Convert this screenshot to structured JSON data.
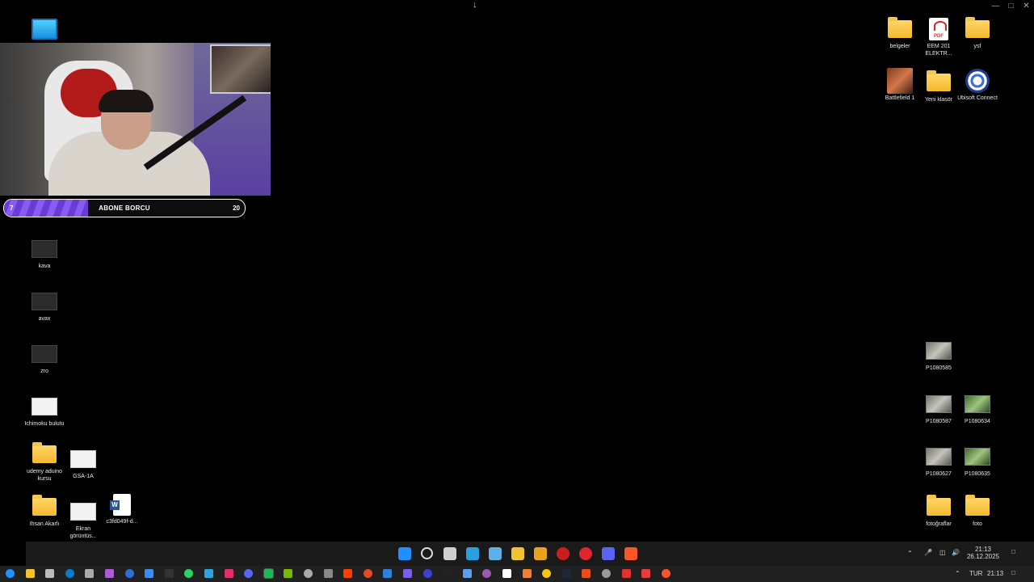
{
  "desktop": {
    "left_icons": [
      {
        "label": "kava",
        "kind": "thumb"
      },
      {
        "label": "avax",
        "kind": "thumb"
      },
      {
        "label": "zro",
        "kind": "thumb"
      },
      {
        "label": "Ichimoku bulutu",
        "kind": "thumb-white"
      },
      {
        "label": "udemy aduino kursu",
        "kind": "folder"
      },
      {
        "label": "GSA-1A",
        "kind": "thumb-white"
      },
      {
        "label": "Ihsan Akarlı",
        "kind": "folder"
      },
      {
        "label": "Ekran görüntüs...",
        "kind": "thumb-white"
      },
      {
        "label": "c3fd049f-d...",
        "kind": "word"
      }
    ],
    "right_icons": [
      {
        "label": "belgeler",
        "kind": "folder"
      },
      {
        "label": "EEM 201 ELEKTR...",
        "kind": "pdf"
      },
      {
        "label": "ysf",
        "kind": "folder"
      },
      {
        "label": "Battlefield 1",
        "kind": "game"
      },
      {
        "label": "Yeni klasör",
        "kind": "folder"
      },
      {
        "label": "Ubisoft Connect",
        "kind": "ubisoft"
      },
      {
        "label": "P1080585",
        "kind": "photo"
      },
      {
        "label": "P1080587",
        "kind": "photo"
      },
      {
        "label": "P1080634",
        "kind": "photo-green"
      },
      {
        "label": "P1080627",
        "kind": "photo"
      },
      {
        "label": "P1080635",
        "kind": "photo-green"
      },
      {
        "label": "fotoğraflar",
        "kind": "folder"
      },
      {
        "label": "foto",
        "kind": "folder"
      }
    ],
    "pdf_badge": "PDF",
    "word_badge": "W"
  },
  "overlay": {
    "sub_goal_title": "ABONE BORCU",
    "sub_current": "7",
    "sub_target": "20",
    "sub_progress": 0.35
  },
  "taskbar": {
    "clock_time": "21:13",
    "clock_date": "26.12.2025",
    "lang": "TUR",
    "bottom_time": "21:13",
    "center_icons": [
      "windows-start-icon",
      "search-icon",
      "task-view-icon",
      "monitor-icon",
      "mail-icon",
      "file-explorer-icon",
      "chrome-icon",
      "opera-icon",
      "opera-gx-icon",
      "discord-icon",
      "brave-icon"
    ],
    "center_colors": [
      "#1e90ff",
      "#d0d0d0",
      "#cfcfcf",
      "#28a0e0",
      "#5fb0e8",
      "#f1c232",
      "#e8a21b",
      "#c81e1e",
      "#e0252c",
      "#5865f2",
      "#fb542b"
    ]
  }
}
